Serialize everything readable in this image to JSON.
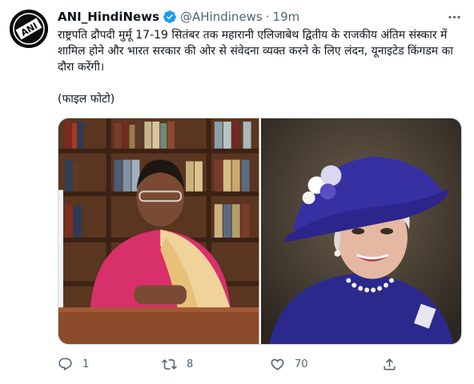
{
  "account": {
    "display_name": "ANI_HindiNews",
    "handle": "@AHindinews",
    "separator": "·",
    "time": "19m",
    "avatar_text": "ANI"
  },
  "tweet": {
    "text": "राष्ट्रपति द्रौपदी मुर्मू 17-19 सितंबर तक महारानी एलिजाबेथ द्वितीय के राजकीय अंतिम संस्कार में शामिल होने और भारत सरकार की ओर से संवेदना व्यक्त करने के लिए लंदन, यूनाइटेड किंगडम का दौरा करेंगी।",
    "caption": "(फाइल फोटो)"
  },
  "actions": {
    "reply_count": "1",
    "retweet_count": "8",
    "like_count": "70"
  },
  "colors": {
    "text": "#0f1419",
    "secondary": "#536471",
    "verified": "#1d9bf0",
    "border": "#cfd9de"
  },
  "icons": [
    "verified-badge-icon",
    "more-icon",
    "reply-icon",
    "retweet-icon",
    "like-icon",
    "share-icon"
  ]
}
